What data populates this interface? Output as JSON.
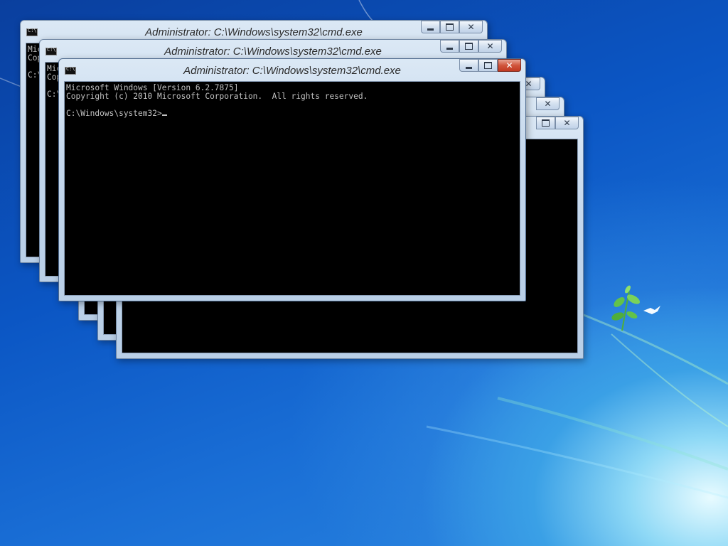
{
  "desktop": {
    "accent": "#0b56c4"
  },
  "windows": [
    {
      "title": "Administrator: C:\\Windows\\system32\\cmd.exe",
      "lines": [
        "Mic",
        "Cop",
        "",
        "C:\\"
      ]
    },
    {
      "title": "Administrator: C:\\Windows\\system32\\cmd.exe",
      "lines": [
        "Mic",
        "Cop",
        "",
        "C:\\"
      ]
    },
    {
      "title": "Administrator: C:\\Windows\\system32\\cmd.exe",
      "lines": [
        "Microsoft Windows [Version 6.2.7875]",
        "Copyright (c) 2010 Microsoft Corporation.  All rights reserved.",
        "",
        "C:\\Windows\\system32>"
      ]
    }
  ],
  "buttons": {
    "minimize": "minimize-icon",
    "maximize": "maximize-icon",
    "close": "close-icon",
    "close_glyph": "✕"
  }
}
